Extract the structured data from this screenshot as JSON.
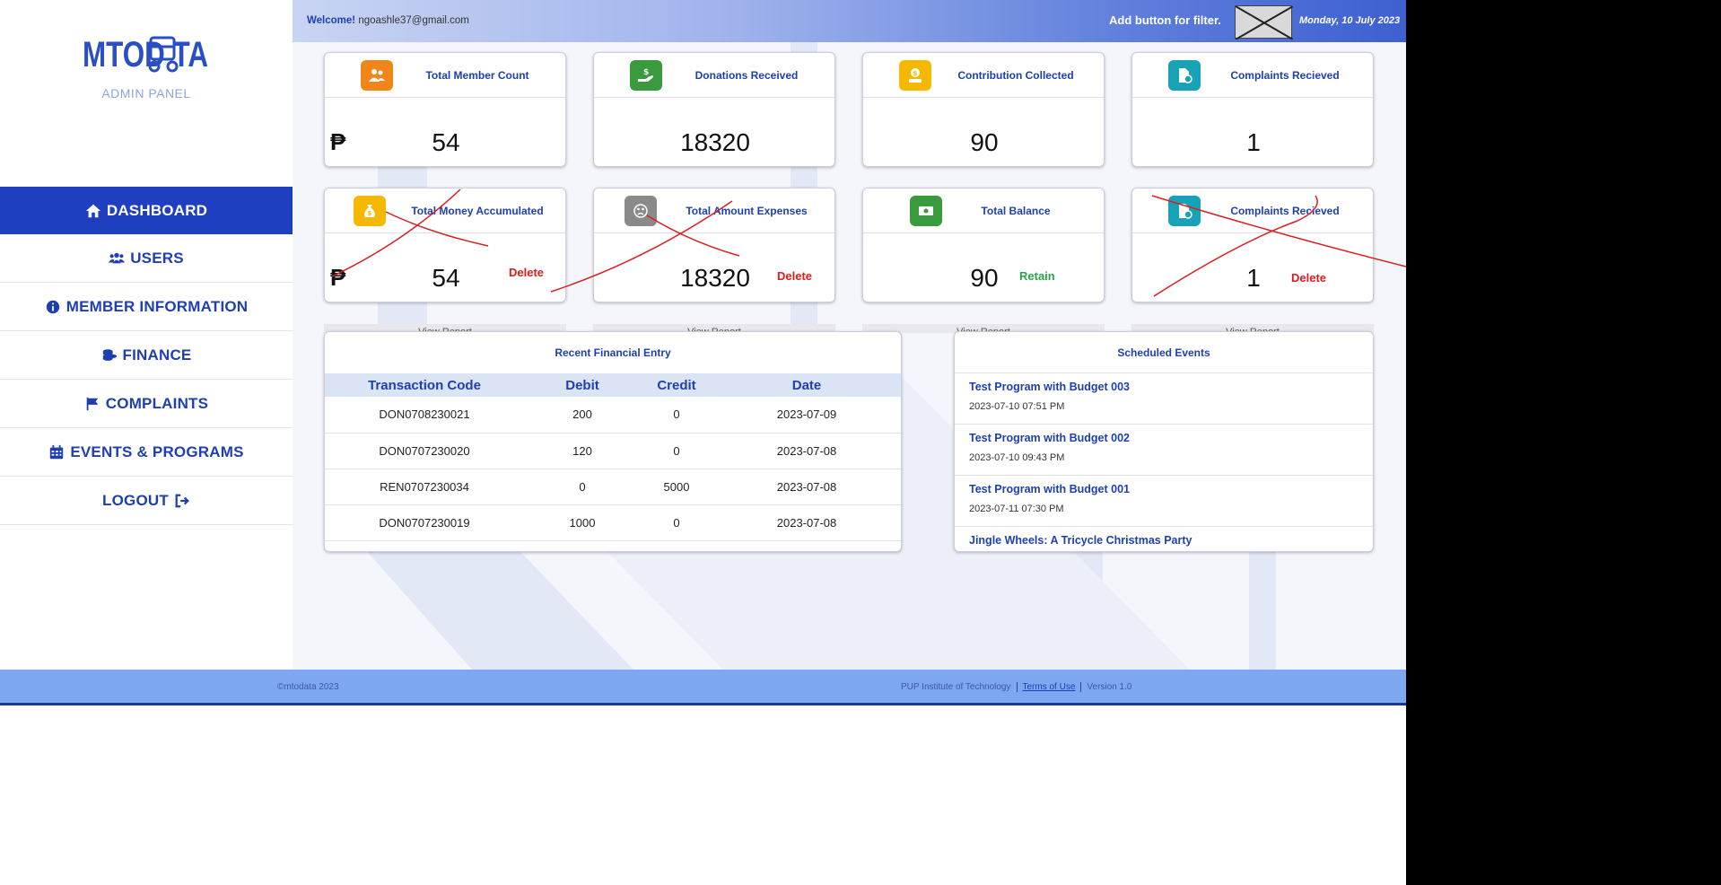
{
  "sidebar": {
    "logo_text": "MTODATA",
    "subtitle": "ADMIN PANEL",
    "nav": [
      {
        "label": "DASHBOARD",
        "icon": "home-icon"
      },
      {
        "label": "USERS",
        "icon": "users-icon"
      },
      {
        "label": "MEMBER INFORMATION",
        "icon": "info-circle-icon"
      },
      {
        "label": "FINANCE",
        "icon": "coins-icon"
      },
      {
        "label": "COMPLAINTS",
        "icon": "flag-icon"
      },
      {
        "label": "EVENTS & PROGRAMS",
        "icon": "calendar-icon"
      },
      {
        "label": "LOGOUT",
        "icon": "sign-out-icon"
      }
    ]
  },
  "topbar": {
    "welcome_label": "Welcome!",
    "email": "ngoashle37@gmail.com",
    "filter_text": "Add button for filter.",
    "date": "Monday, 10 July 2023"
  },
  "cards_row1": [
    {
      "title": "Total Member Count",
      "value": "54",
      "currency": "₱",
      "icon_color": "#f0861a"
    },
    {
      "title": "Donations Received",
      "value": "18320",
      "icon_color": "#3a9a3e"
    },
    {
      "title": "Contribution Collected",
      "value": "90",
      "icon_color": "#f5b800"
    },
    {
      "title": "Complaints Recieved",
      "value": "1",
      "icon_color": "#17a2b8"
    }
  ],
  "cards_row2": [
    {
      "title": "Total Money Accumulated",
      "value": "54",
      "currency": "₱",
      "action": "Delete",
      "icon_color": "#f5b800"
    },
    {
      "title": "Total Amount Expenses",
      "value": "18320",
      "action": "Delete",
      "icon_color": "#8a8a8a"
    },
    {
      "title": "Total Balance",
      "value": "90",
      "action": "Retain",
      "icon_color": "#3a9a3e"
    },
    {
      "title": "Complaints Recieved",
      "value": "1",
      "action": "Delete",
      "icon_color": "#17a2b8"
    }
  ],
  "view_report_label": "View Report",
  "financial": {
    "title": "Recent Financial Entry",
    "columns": [
      "Transaction Code",
      "Debit",
      "Credit",
      "Date"
    ],
    "rows": [
      [
        "DON0708230021",
        "200",
        "0",
        "2023-07-09"
      ],
      [
        "DON0707230020",
        "120",
        "0",
        "2023-07-08"
      ],
      [
        "REN0707230034",
        "0",
        "5000",
        "2023-07-08"
      ],
      [
        "DON0707230019",
        "1000",
        "0",
        "2023-07-08"
      ]
    ]
  },
  "events": {
    "title": "Scheduled Events",
    "items": [
      {
        "title": "Test Program with Budget 003",
        "date": "2023-07-10 07:51 PM"
      },
      {
        "title": "Test Program with Budget 002",
        "date": "2023-07-10 09:43 PM"
      },
      {
        "title": "Test Program with Budget 001",
        "date": "2023-07-11 07:30 PM"
      },
      {
        "title": "Jingle Wheels: A Tricycle Christmas Party",
        "date": ""
      }
    ]
  },
  "footer": {
    "copyright": "©mtodata 2023",
    "institute": "PUP Institute of Technology",
    "terms": "Terms of Use",
    "version": "Version 1.0"
  },
  "colors": {
    "brand": "#1e3fbf",
    "delete": "#e01b1b",
    "retain": "#2aa54a",
    "footer": "#7ea7f2"
  }
}
